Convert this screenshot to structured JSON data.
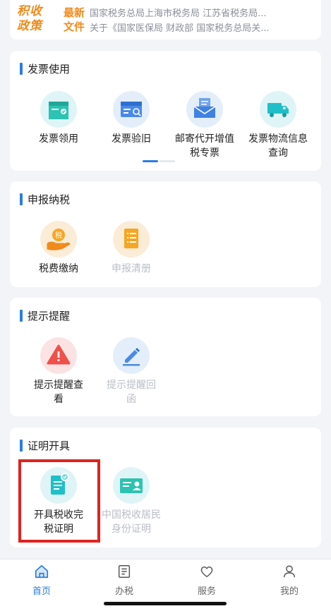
{
  "banner": {
    "policy_logo": [
      "积收",
      "政策"
    ],
    "latest_logo": [
      "最新",
      "文件"
    ],
    "news": [
      "国家税务总局上海市税务局 江苏省税务局...",
      "关于《国家医保局 财政部 国家税务总局关..."
    ]
  },
  "sections": {
    "invoice": {
      "title": "发票使用",
      "items": [
        {
          "label": "发票领用",
          "icon": "invoice-receive-icon"
        },
        {
          "label": "发票验旧",
          "icon": "invoice-verify-icon"
        },
        {
          "label": "邮寄代开增值税专票",
          "icon": "mail-invoice-icon"
        },
        {
          "label": "发票物流信息查询",
          "icon": "truck-icon"
        }
      ]
    },
    "tax": {
      "title": "申报纳税",
      "items": [
        {
          "label": "税费缴纳",
          "icon": "tax-payment-icon"
        },
        {
          "label": "申报清册",
          "icon": "declaration-list-icon"
        }
      ]
    },
    "reminder": {
      "title": "提示提醒",
      "items": [
        {
          "label": "提示提醒查看",
          "icon": "warning-icon"
        },
        {
          "label": "提示提醒回函",
          "icon": "pen-reply-icon"
        }
      ]
    },
    "certificate": {
      "title": "证明开具",
      "items": [
        {
          "label": "开具税收完税证明",
          "icon": "tax-certificate-icon"
        },
        {
          "label": "中国税收居民身份证明",
          "icon": "resident-id-icon"
        }
      ]
    }
  },
  "tabs": [
    {
      "label": "首页",
      "icon": "home-icon",
      "active": true
    },
    {
      "label": "办税",
      "icon": "list-icon",
      "active": false
    },
    {
      "label": "服务",
      "icon": "heart-icon",
      "active": false
    },
    {
      "label": "我的",
      "icon": "user-icon",
      "active": false
    }
  ],
  "colors": {
    "accent": "#2a7de1",
    "highlight": "#e0221f",
    "orange": "#f08a1a"
  }
}
